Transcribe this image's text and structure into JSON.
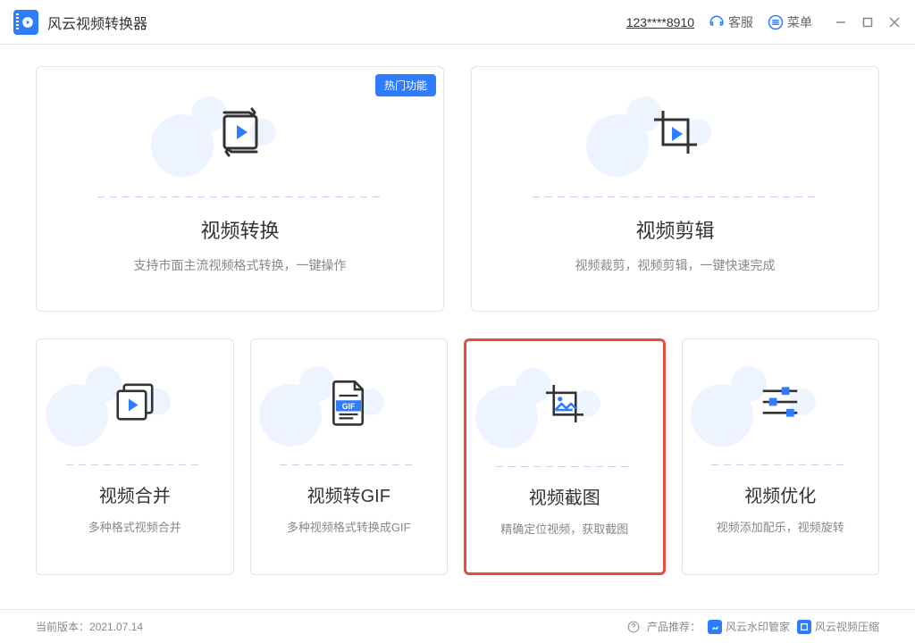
{
  "app": {
    "title": "风云视频转换器"
  },
  "titlebar": {
    "user_id": "123****8910",
    "support_label": "客服",
    "menu_label": "菜单"
  },
  "cards": {
    "hot_badge": "热门功能",
    "convert": {
      "title": "视频转换",
      "desc": "支持市面主流视频格式转换，一键操作"
    },
    "edit": {
      "title": "视频剪辑",
      "desc": "视频裁剪，视频剪辑，一键快速完成"
    },
    "merge": {
      "title": "视频合并",
      "desc": "多种格式视频合并"
    },
    "gif": {
      "title": "视频转GIF",
      "desc": "多种视频格式转换成GIF",
      "gif_label": "GIF"
    },
    "screenshot": {
      "title": "视频截图",
      "desc": "精确定位视频，获取截图"
    },
    "optimize": {
      "title": "视频优化",
      "desc": "视频添加配乐，视频旋转"
    }
  },
  "footer": {
    "version_label": "当前版本：",
    "version": "2021.07.14",
    "recommend_label": "产品推荐：",
    "rec1": "风云水印管家",
    "rec2": "风云视频压缩"
  }
}
